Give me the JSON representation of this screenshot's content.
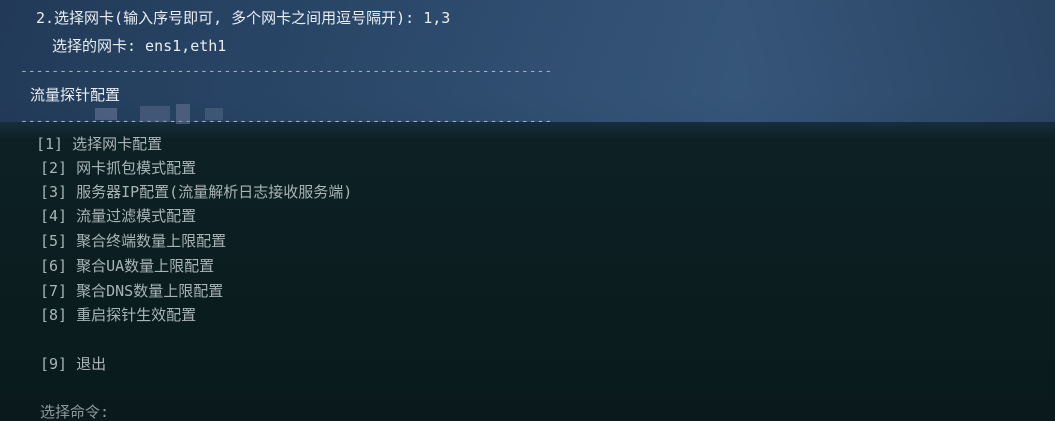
{
  "prompt": {
    "nic_select_line": "2.选择网卡(输入序号即可, 多个网卡之间用逗号隔开): 1,3",
    "selected_nics_line": "选择的网卡: ens1,eth1"
  },
  "separator": "--------------------------------------------------------------------",
  "section_title": "流量探针配置",
  "menu": {
    "items": [
      {
        "label": "[1] 选择网卡配置"
      },
      {
        "label": "[2] 网卡抓包模式配置"
      },
      {
        "label": "[3] 服务器IP配置(流量解析日志接收服务端)"
      },
      {
        "label": "[4] 流量过滤模式配置"
      },
      {
        "label": "[5] 聚合终端数量上限配置"
      },
      {
        "label": "[6] 聚合UA数量上限配置"
      },
      {
        "label": "[7] 聚合DNS数量上限配置"
      },
      {
        "label": "[8] 重启探针生效配置"
      }
    ],
    "exit_label": "[9] 退出"
  },
  "command_prompt": "选择命令:",
  "colors": {
    "background": "#0a1a1c",
    "header_band": "#2c4a6c",
    "text_bright": "#e8eef2",
    "text_dim": "#a9b4b8"
  }
}
